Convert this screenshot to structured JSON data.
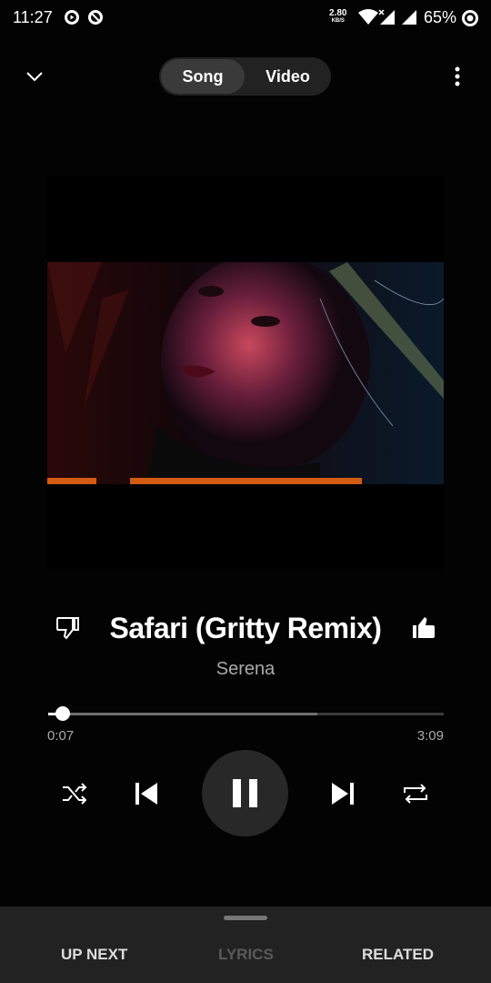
{
  "status_bar": {
    "time": "11:27",
    "net_speed_value": "2.80",
    "net_speed_unit": "KB/S",
    "battery": "65%"
  },
  "header": {
    "toggle_song": "Song",
    "toggle_video": "Video",
    "collapse_icon": "chevron-down-icon",
    "more_icon": "more-vert-icon"
  },
  "player": {
    "title": "Safari (Gritty Remix)",
    "artist": "Serena",
    "elapsed": "0:07",
    "total": "3:09",
    "progress_fraction": 0.037,
    "buffer_fraction": 0.68,
    "accent_color": "#d35a13"
  },
  "controls": {
    "shuffle_icon": "shuffle-icon",
    "previous_icon": "skip-previous-icon",
    "play_pause_icon": "pause-icon",
    "next_icon": "skip-next-icon",
    "repeat_icon": "repeat-icon"
  },
  "bottom_tabs": {
    "up_next": "UP NEXT",
    "lyrics": "LYRICS",
    "related": "RELATED"
  }
}
